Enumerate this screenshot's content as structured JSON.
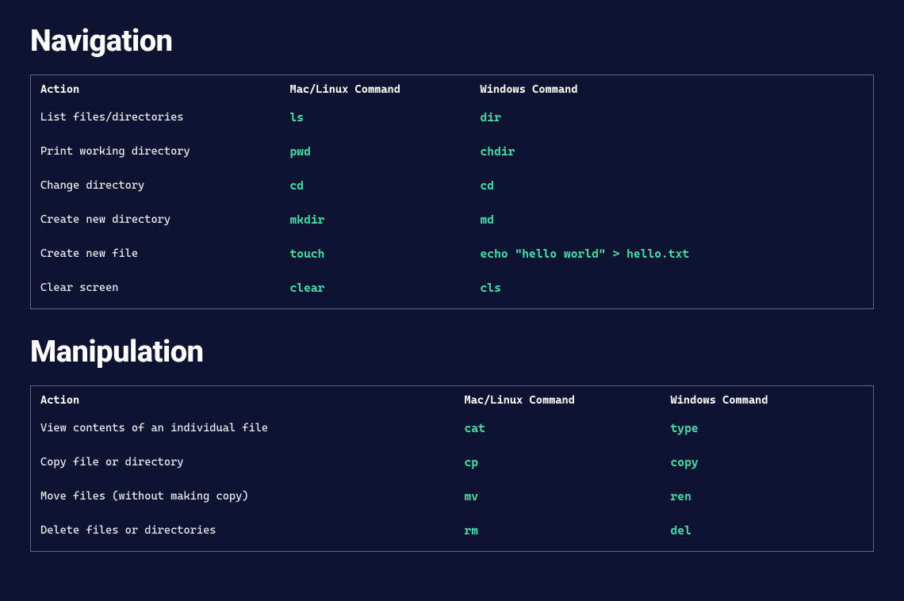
{
  "sections": [
    {
      "name": "navigation",
      "heading": "Navigation",
      "tableClass": "navigation-table",
      "columns": [
        "Action",
        "Mac/Linux Command",
        "Windows Command"
      ],
      "rows": [
        {
          "action": "List files/directories",
          "mac": "ls",
          "win": "dir"
        },
        {
          "action": "Print working directory",
          "mac": "pwd",
          "win": "chdir"
        },
        {
          "action": "Change directory",
          "mac": "cd",
          "win": "cd"
        },
        {
          "action": "Create new directory",
          "mac": "mkdir",
          "win": "md"
        },
        {
          "action": "Create new file",
          "mac": "touch",
          "win": "echo \"hello world\" > hello.txt"
        },
        {
          "action": "Clear screen",
          "mac": "clear",
          "win": "cls"
        }
      ]
    },
    {
      "name": "manipulation",
      "heading": "Manipulation",
      "tableClass": "manipulation-table",
      "columns": [
        "Action",
        "Mac/Linux Command",
        "Windows Command"
      ],
      "rows": [
        {
          "action": "View contents of an individual file",
          "mac": "cat",
          "win": "type"
        },
        {
          "action": "Copy file or directory",
          "mac": "cp",
          "win": "copy"
        },
        {
          "action": "Move files (without making copy)",
          "mac": "mv",
          "win": "ren"
        },
        {
          "action": "Delete files or directories",
          "mac": "rm",
          "win": "del"
        }
      ]
    }
  ]
}
